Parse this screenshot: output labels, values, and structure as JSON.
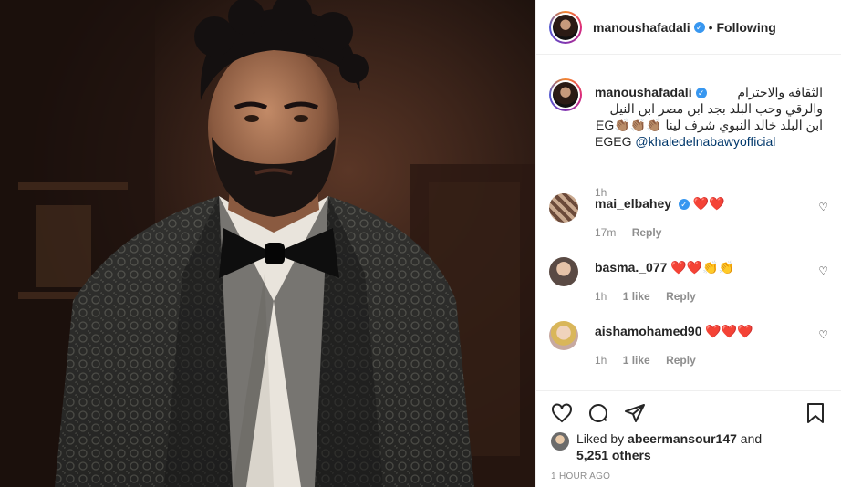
{
  "post": {
    "username": "manoushafadali",
    "follow_status": "Following",
    "separator": "•"
  },
  "caption": {
    "username": "manoushafadali",
    "line1": "الثقافه والاحترام",
    "line2": "والرقي وحب البلد بجد ابن مصر ابن النيل",
    "line3": "ابن البلد خالد النبوي شرف لينا 👏🏽👏🏽👏🏽EG",
    "line4_prefix": "EGEG",
    "mention": "@khaledelnabawyofficial",
    "time": "1h"
  },
  "comments": [
    {
      "username": "mai_elbahey",
      "text": "❤️❤️",
      "time": "17m",
      "likes": "",
      "reply": "Reply"
    },
    {
      "username": "basma._077",
      "text": "❤️❤️👏👏",
      "time": "1h",
      "likes": "1 like",
      "reply": "Reply"
    },
    {
      "username": "aishamohamed90",
      "text": "❤️❤️❤️",
      "time": "1h",
      "likes": "1 like",
      "reply": "Reply"
    }
  ],
  "liked_by": {
    "prefix": "Liked by",
    "user": "abeermansour147",
    "and": "and",
    "others": "5,251 others"
  },
  "timestamp": "1 HOUR AGO",
  "icons": [
    "heart-icon",
    "comment-icon",
    "share-icon",
    "save-icon",
    "verified-icon"
  ],
  "colors": {
    "verified": "#3897f0",
    "heart": "#ed4956",
    "link": "#00376b",
    "muted": "#8e8e8e"
  }
}
